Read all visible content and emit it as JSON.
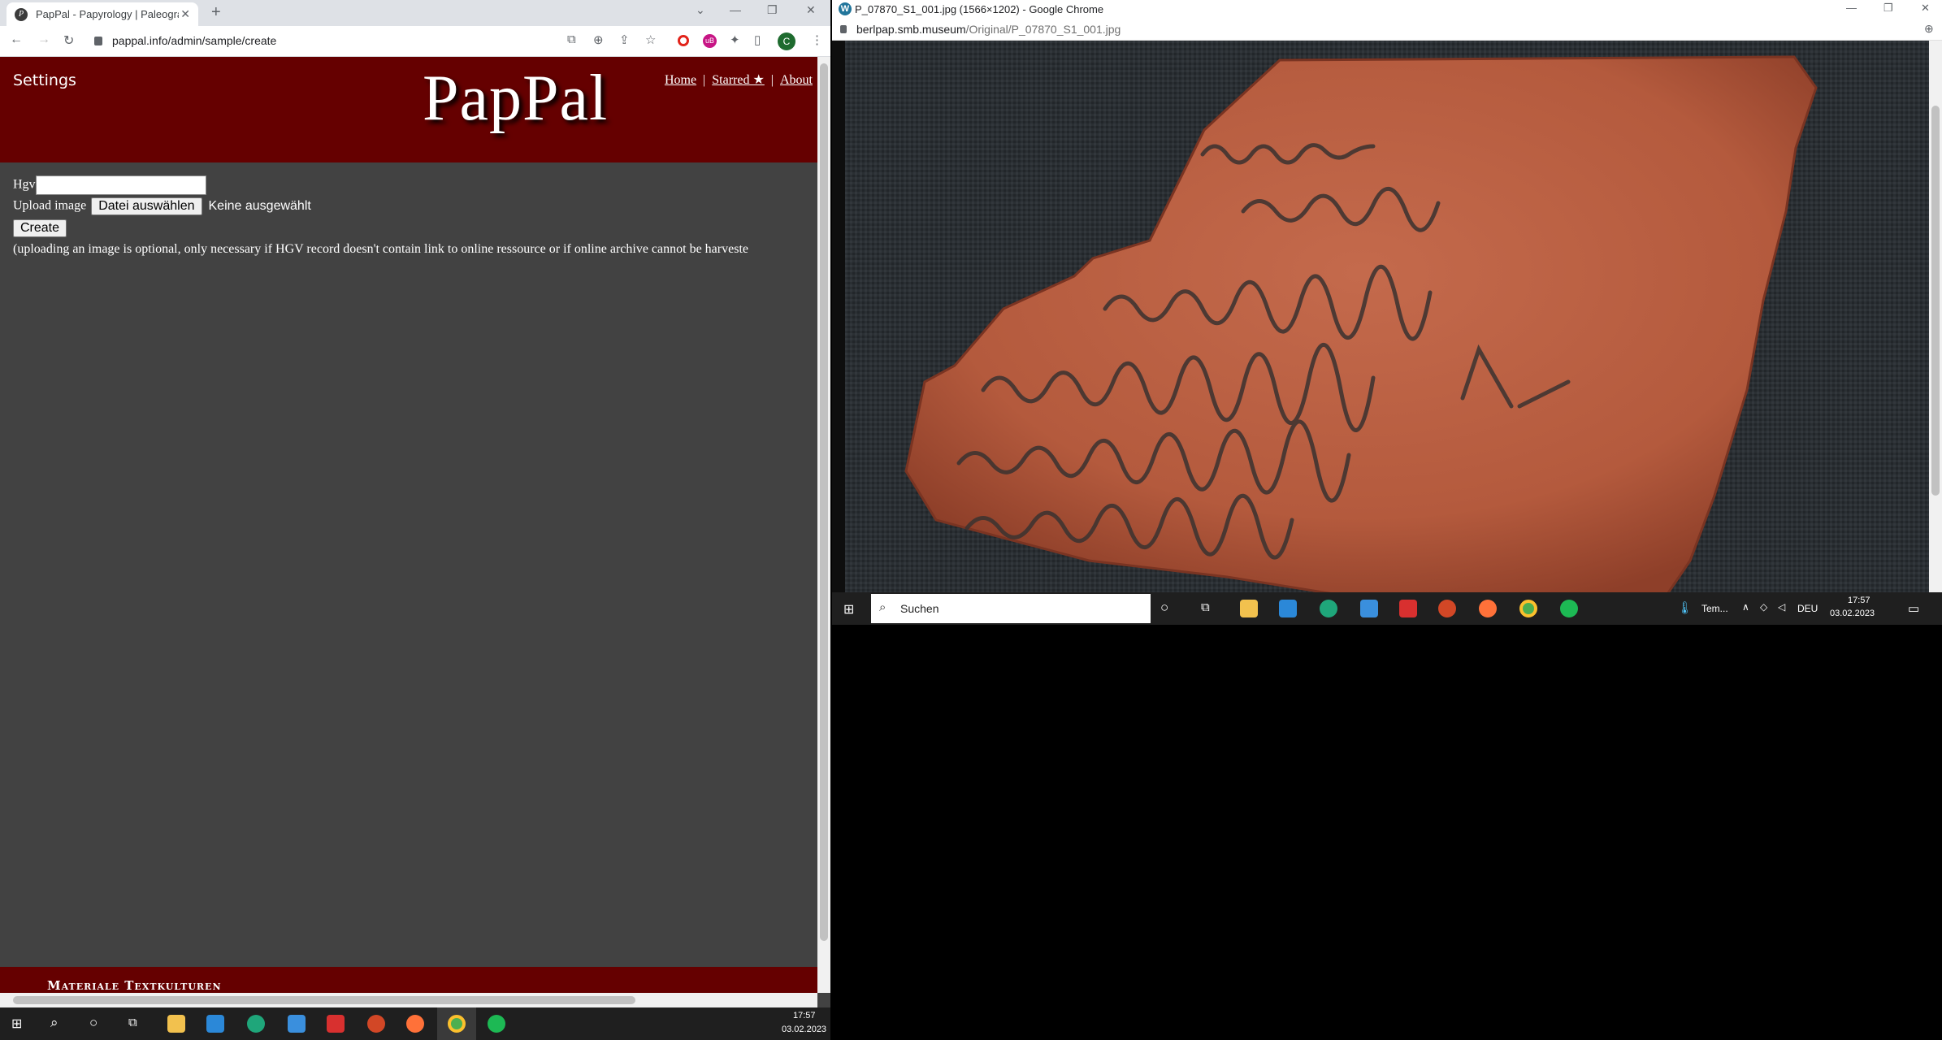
{
  "left_browser": {
    "tab_title": "PapPal - Papyrology | Paleograph",
    "url": "pappal.info/admin/sample/create",
    "profile_initial": "C",
    "site": {
      "settings_label": "Settings",
      "logo": "PapPal",
      "nav": [
        "Home",
        "Starred ★",
        "About"
      ],
      "form": {
        "hgv_label": "Hgv",
        "hgv_value": "",
        "upload_label": "Upload image",
        "file_button": "Datei auswählen",
        "file_status": "Keine ausgewählt",
        "create_button": "Create",
        "note": "(uploading an image is optional, only necessary if HGV record doesn't contain link to online ressource or if online archive cannot be harveste"
      },
      "footer_text": "Materiale Textkulturen"
    }
  },
  "right_browser": {
    "title": "P_07870_S1_001.jpg (1566×1202) - Google Chrome",
    "url_host": "berlpap.smb.museum",
    "url_path": "/Original/P_07870_S1_001.jpg"
  },
  "right_taskbar": {
    "search_placeholder": "Suchen",
    "weather": "Tem...",
    "lang": "DEU",
    "time": "17:57",
    "date": "03.02.2023"
  },
  "bottom_taskbar": {
    "time": "17:57",
    "date": "03.02.2023"
  },
  "colors": {
    "header_red": "#650000",
    "page_bg": "#424242",
    "ostracon": "#b85a3e"
  }
}
